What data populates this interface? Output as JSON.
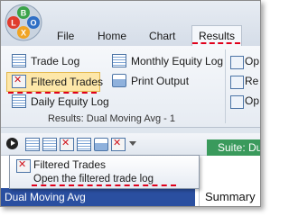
{
  "app": {
    "logo_letters": [
      "B",
      "L",
      "O",
      "X"
    ]
  },
  "tabs": [
    {
      "label": "File"
    },
    {
      "label": "Home"
    },
    {
      "label": "Chart"
    },
    {
      "label": "Results",
      "active": true
    }
  ],
  "ribbon": {
    "buttons": {
      "trade_log": "Trade Log",
      "filtered_trades": "Filtered Trades",
      "daily_equity_log": "Daily Equity Log",
      "monthly_equity_log": "Monthly Equity Log",
      "print_output": "Print Output"
    },
    "group_label": "Results: Dual Moving Avg - 1",
    "side_items": [
      "Op",
      "Re",
      "Op"
    ]
  },
  "toolbar": {
    "suite_label": "Suite: Dual"
  },
  "tooltip": {
    "title": "Filtered Trades",
    "description": "Open the filtered trade log"
  },
  "panel": {
    "selected_item": "Dual Moving Avg",
    "summary_label": "Summary R"
  },
  "colors": {
    "highlight_underline": "#e0001b",
    "active_button": "#fde7a9",
    "suite_tab": "#3a9a5c",
    "selected_row": "#2a4fa0"
  }
}
